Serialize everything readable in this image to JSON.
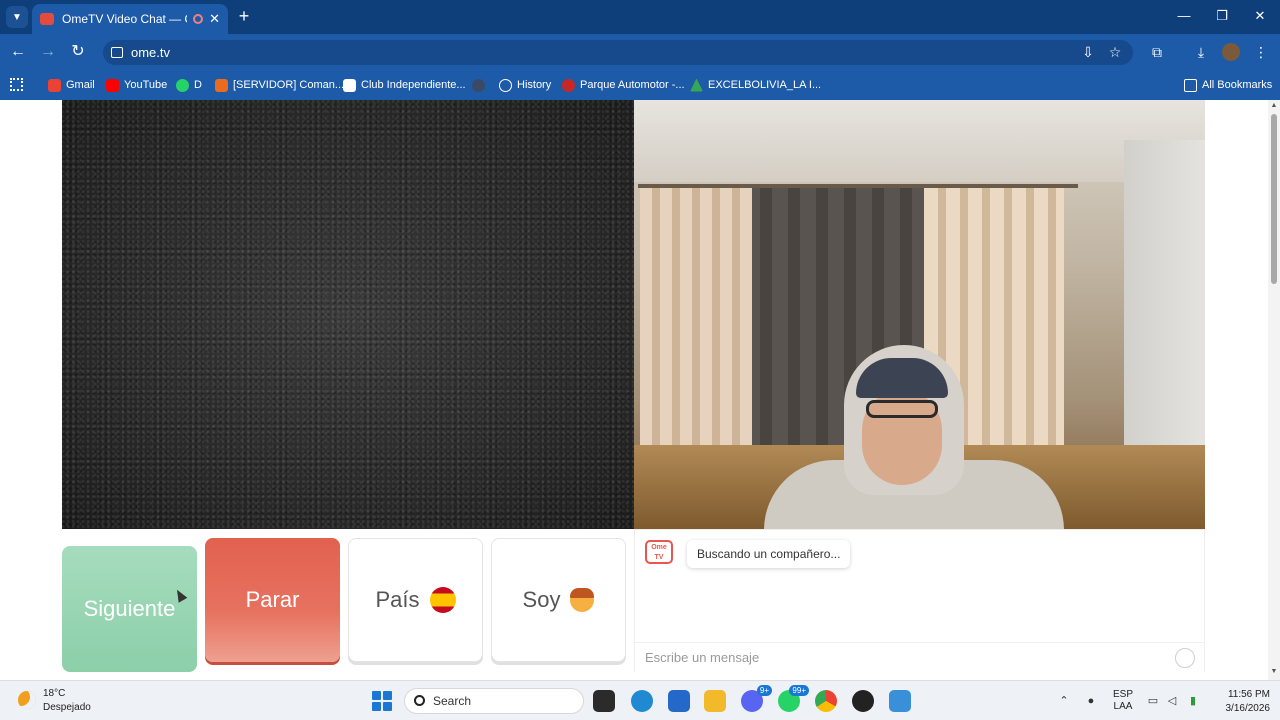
{
  "browser": {
    "tab_title": "OmeTV Video Chat — Ome",
    "url": "ome.tv",
    "bookmarks": [
      {
        "label": "Gmail",
        "color": "#ea4335"
      },
      {
        "label": "YouTube",
        "color": "#ff0000"
      },
      {
        "label": "D",
        "color": "#25d366"
      },
      {
        "label": "[SERVIDOR] Coman...",
        "color": "#e86b1f"
      },
      {
        "label": "Club Independiente...",
        "color": "#ffffff"
      },
      {
        "label": "History",
        "color": "#ffffff"
      },
      {
        "label": "Parque Automotor -...",
        "color": "#c62828"
      },
      {
        "label": "EXCELBOLIVIA_LA I...",
        "color": "#34a853"
      }
    ],
    "all_bookmarks": "All Bookmarks"
  },
  "controls": {
    "next": "Siguiente",
    "stop": "Parar",
    "country": "País",
    "soy": "Soy"
  },
  "chat": {
    "logo_text": "Ome TV",
    "status": "Buscando un compañero...",
    "placeholder": "Escribe un mensaje"
  },
  "taskbar": {
    "weather_temp": "18°C",
    "weather_desc": "Despejado",
    "search": "Search",
    "lang_top": "ESP",
    "lang_bottom": "LAA",
    "time": "11:56 PM",
    "date": "3/16/2026",
    "badge_discord": "9+",
    "badge_whatsapp": "99+"
  },
  "colors": {
    "browser_frame": "#1d5aa8",
    "next_button": "#8ccfa9",
    "stop_button": "#e2614f",
    "ome_brand": "#e9574a"
  }
}
